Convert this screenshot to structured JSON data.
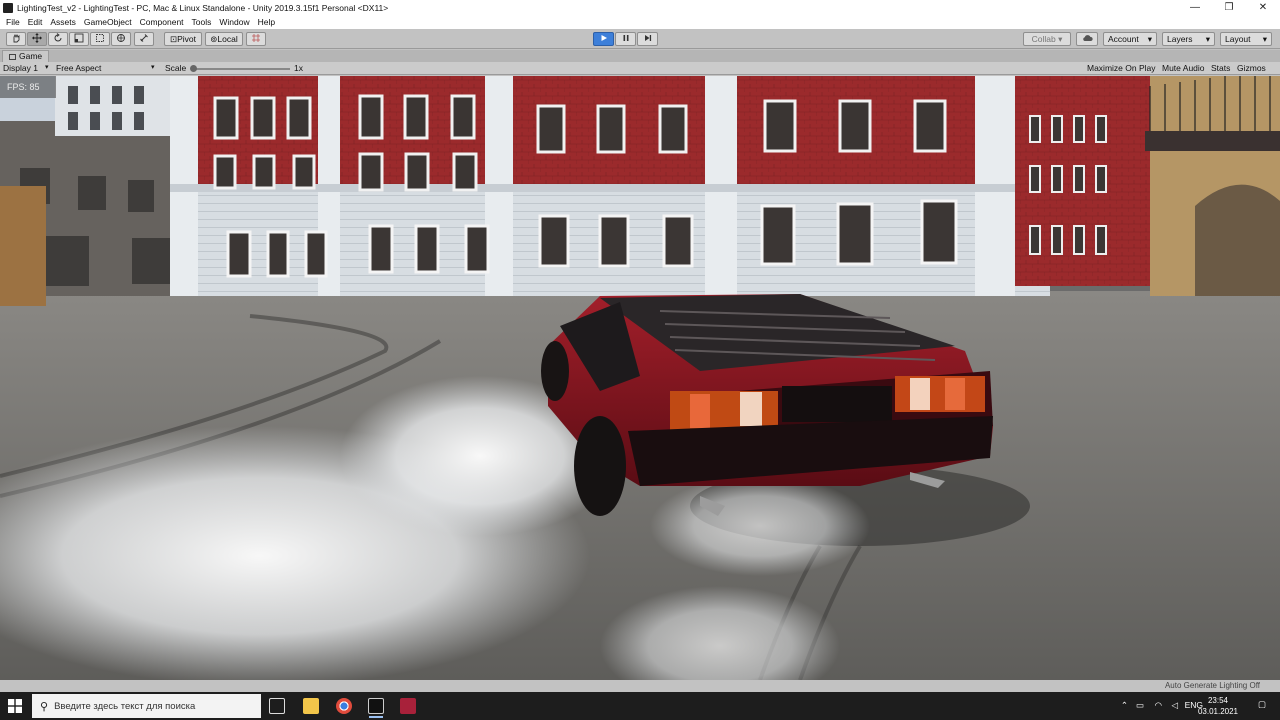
{
  "window": {
    "title": "LightingTest_v2 - LightingTest - PC, Mac & Linux Standalone - Unity 2019.3.15f1 Personal <DX11>",
    "minimize": "—",
    "restore": "❐",
    "close": "✕"
  },
  "menu": [
    "File",
    "Edit",
    "Assets",
    "GameObject",
    "Component",
    "Tools",
    "Window",
    "Help"
  ],
  "toolbar": {
    "pivot": "Pivot",
    "local": "Local",
    "collab": "Collab ▾",
    "account": "Account",
    "layers": "Layers",
    "layout": "Layout"
  },
  "game_tab": {
    "label": "Game"
  },
  "game_bar": {
    "display": "Display 1",
    "aspect": "Free Aspect",
    "scale_label": "Scale",
    "scale_value": "1x",
    "maximize": "Maximize On Play",
    "mute": "Mute Audio",
    "stats": "Stats",
    "gizmos": "Gizmos"
  },
  "viewport": {
    "fps": "FPS: 85"
  },
  "status": {
    "text": "Auto Generate Lighting Off"
  },
  "taskbar": {
    "search_placeholder": "Введите здесь текст для поиска",
    "lang": "ENG",
    "time": "23:54",
    "date": "03.01.2021"
  },
  "colors": {
    "play_active": "#3d7fd9",
    "car_body": "#7a121b",
    "building_brick": "#9b2a2c",
    "asphalt": "#6b6b6b"
  }
}
